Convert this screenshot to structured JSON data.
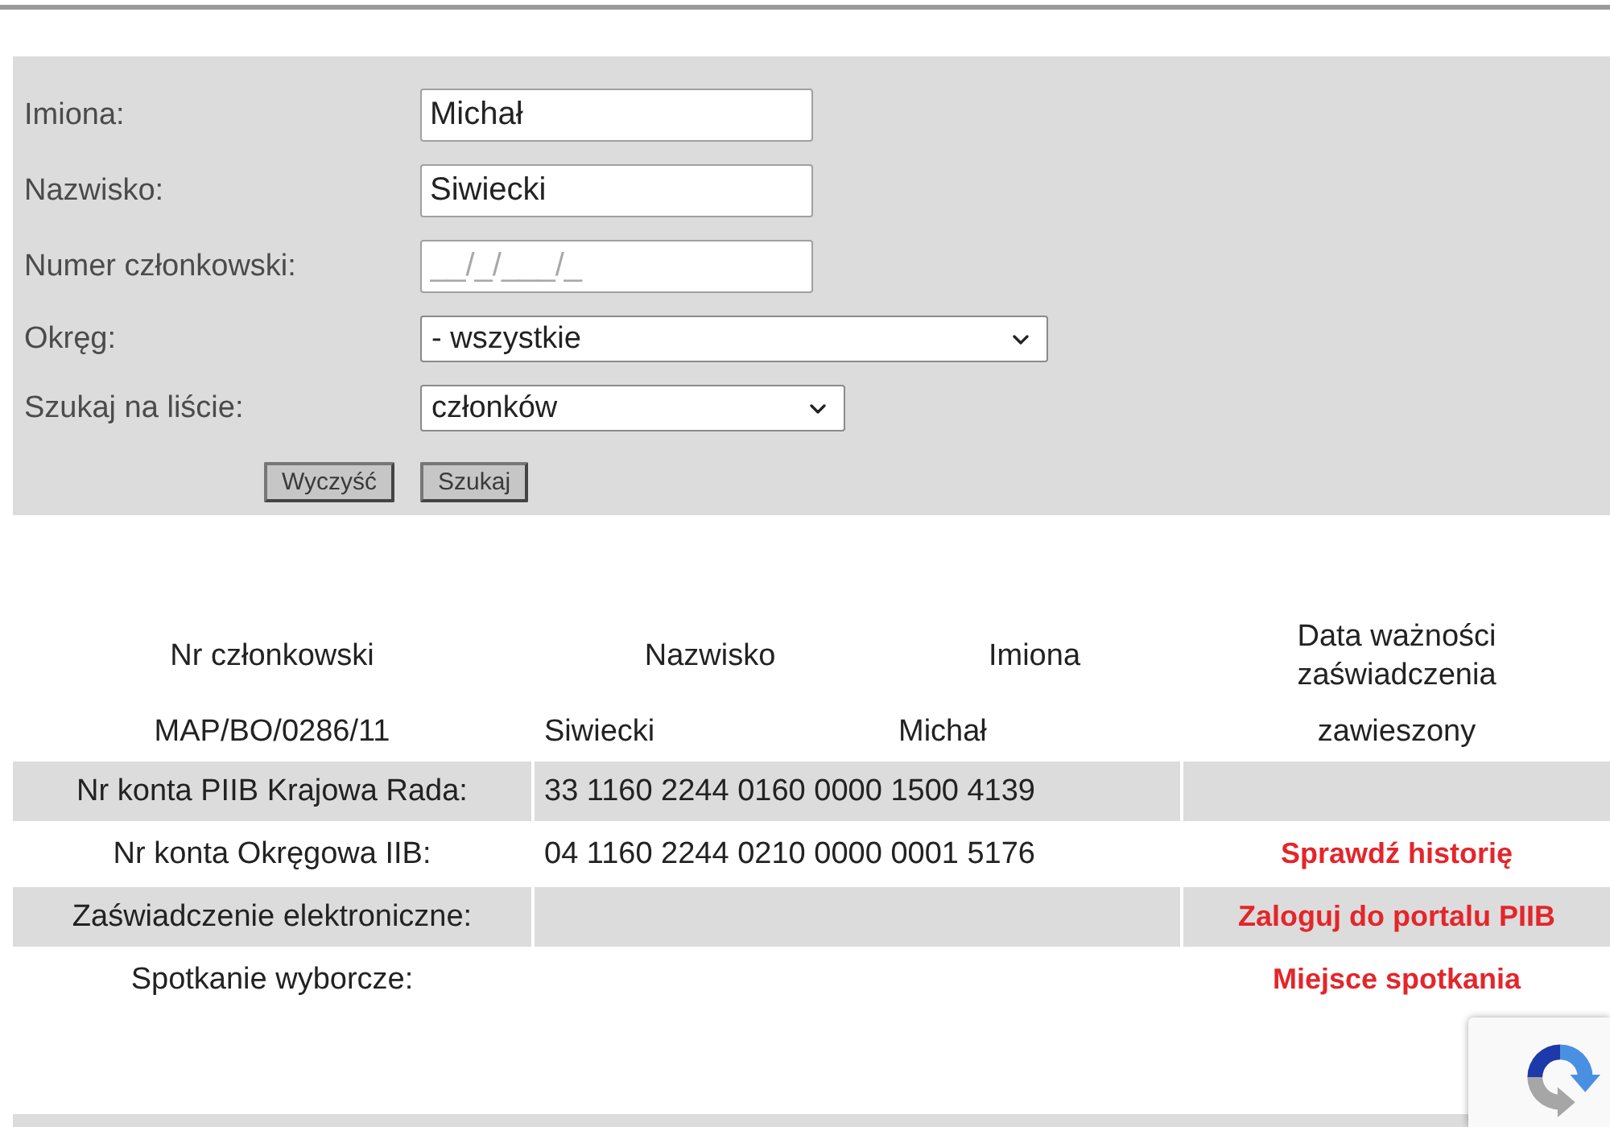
{
  "search_form": {
    "fields": [
      {
        "kind": "text",
        "label": "Imiona:",
        "value": "Michał"
      },
      {
        "kind": "text",
        "label": "Nazwisko:",
        "value": "Siwiecki"
      },
      {
        "kind": "text",
        "label": "Numer członkowski:",
        "placeholder": "__/_/___/_"
      },
      {
        "kind": "select",
        "label": "Okręg:",
        "value": "- wszystkie"
      },
      {
        "kind": "select",
        "label": "Szukaj na liście:",
        "value": "członków"
      }
    ],
    "buttons": [
      {
        "label": "Wyczyść"
      },
      {
        "label": "Szukaj"
      }
    ]
  },
  "results": {
    "columns": [
      "Nr członkowski",
      "Nazwisko",
      "Imiona",
      "Data ważności zaświadczenia"
    ],
    "member_row": [
      "MAP/BO/0286/11",
      "Siwiecki",
      "Michał",
      "zawieszony"
    ],
    "details": [
      {
        "label": "Nr konta PIIB Krajowa Rada:",
        "value": "33 1160 2244 0160 0000 1500 4139"
      },
      {
        "label": "Nr konta Okręgowa IIB:",
        "value": "04 1160 2244 0210 0000 0001 5176",
        "link": "Sprawdź historię"
      },
      {
        "label": "Zaświadczenie elektroniczne:",
        "link": "Zaloguj do portalu PIIB"
      },
      {
        "label": "Spotkanie wyborcze:",
        "link": "Miejsce spotkania"
      }
    ]
  }
}
